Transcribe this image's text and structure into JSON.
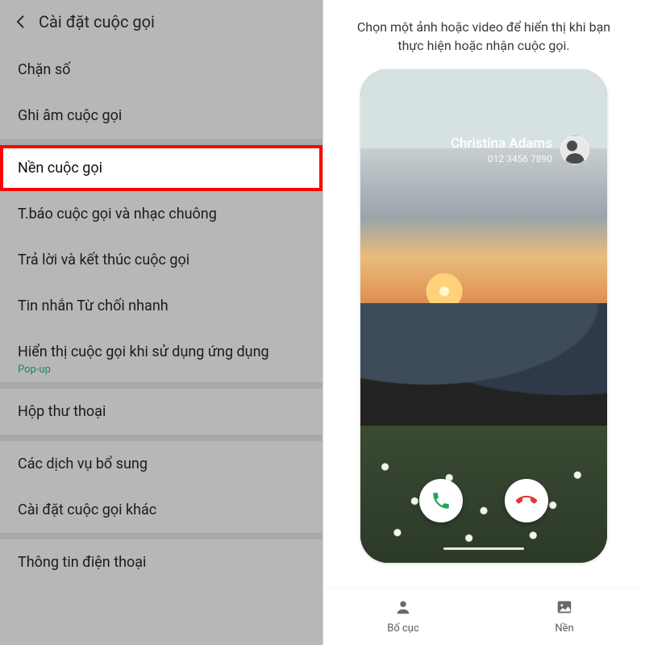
{
  "left": {
    "title": "Cài đặt cuộc gọi",
    "rows": [
      {
        "label": "Chặn số"
      },
      {
        "label": "Ghi âm cuộc gọi"
      },
      {
        "label": "Nền cuộc gọi",
        "highlight": true
      },
      {
        "label": "T.báo cuộc gọi và nhạc chuông"
      },
      {
        "label": "Trả lời và kết thúc cuộc gọi"
      },
      {
        "label": "Tin nhắn Từ chối nhanh"
      },
      {
        "label": "Hiển thị cuộc gọi khi sử dụng ứng dụng",
        "sub": "Pop-up"
      },
      {
        "label": "Hộp thư thoại"
      },
      {
        "label": "Các dịch vụ bổ sung"
      },
      {
        "label": "Cài đặt cuộc gọi khác"
      },
      {
        "label": "Thông tin điện thoại"
      }
    ]
  },
  "right": {
    "description": "Chọn một ảnh hoặc video để hiển thị khi bạn thực hiện hoặc nhận cuộc gọi.",
    "caller_name": "Christina Adams",
    "caller_number": "012 3456 7890",
    "tabs": {
      "layout": "Bố cục",
      "background": "Nền"
    },
    "colors": {
      "answer": "#23a45a",
      "decline": "#e0382f"
    }
  }
}
